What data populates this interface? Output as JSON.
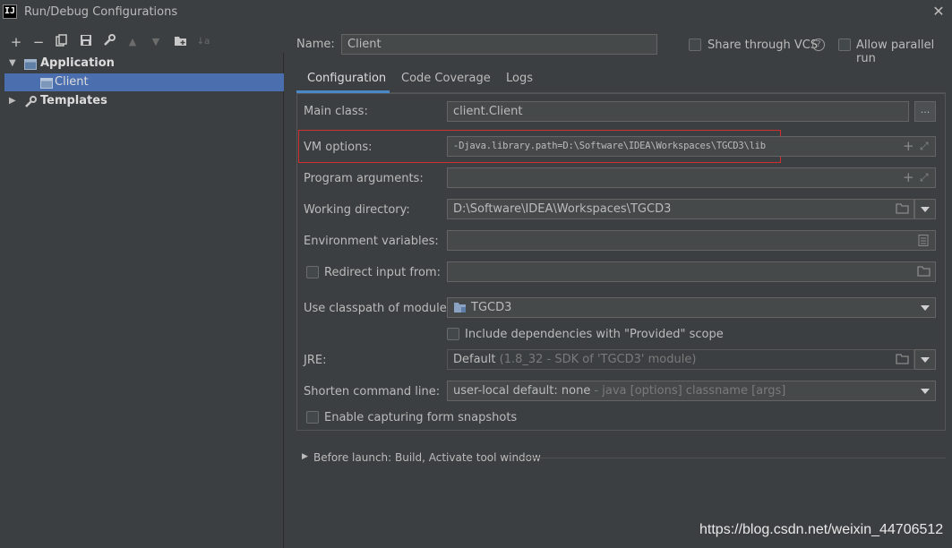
{
  "window": {
    "title": "Run/Debug Configurations",
    "logo_text": "IJ",
    "close_glyph": "✕"
  },
  "toolbar": {
    "add": "+",
    "remove": "−",
    "copy": "⧉",
    "save": "💾",
    "edit_defaults": "🔧",
    "move_up": "▲",
    "move_down": "▼",
    "new_folder": "📁",
    "sort": "↓a"
  },
  "tree": {
    "application_label": "Application",
    "client_label": "Client",
    "templates_label": "Templates"
  },
  "header": {
    "name_label": "Name:",
    "name_value": "Client",
    "share_vcs_label": "Share through VCS",
    "help_glyph": "?",
    "allow_parallel_label": "Allow parallel run"
  },
  "tabs": [
    {
      "label": "Configuration",
      "active": true
    },
    {
      "label": "Code Coverage",
      "active": false
    },
    {
      "label": "Logs",
      "active": false
    }
  ],
  "form": {
    "main_class_label": "Main class:",
    "main_class_value": "client.Client",
    "browse_button": "...",
    "vm_options_label": "VM options:",
    "vm_options_value": "-Djava.library.path=D:\\Software\\IDEA\\Workspaces\\TGCD3\\lib",
    "program_args_label": "Program arguments:",
    "program_args_value": "",
    "working_dir_label": "Working directory:",
    "working_dir_value": "D:\\Software\\IDEA\\Workspaces\\TGCD3",
    "env_vars_label": "Environment variables:",
    "env_vars_value": "",
    "redirect_input_label": "Redirect input from:",
    "redirect_input_value": "",
    "classpath_label": "Use classpath of module:",
    "classpath_value": "TGCD3",
    "include_deps_label": "Include dependencies with \"Provided\" scope",
    "jre_label": "JRE:",
    "jre_value_main": "Default",
    "jre_value_dim": " (1.8_32 - SDK of 'TGCD3' module)",
    "shorten_label": "Shorten command line:",
    "shorten_value_main": "user-local default: none",
    "shorten_value_dim": " - java [options] classname [args]",
    "capture_snapshots_label": "Enable capturing form snapshots"
  },
  "before_launch": {
    "label": "Before launch: Build, Activate tool window"
  },
  "watermark": "https://blog.csdn.net/weixin_44706512",
  "colors": {
    "background": "#3c3f41",
    "selection": "#4b6eaf",
    "tab_accent": "#4a88c7",
    "highlight_box": "#d32f2f"
  }
}
